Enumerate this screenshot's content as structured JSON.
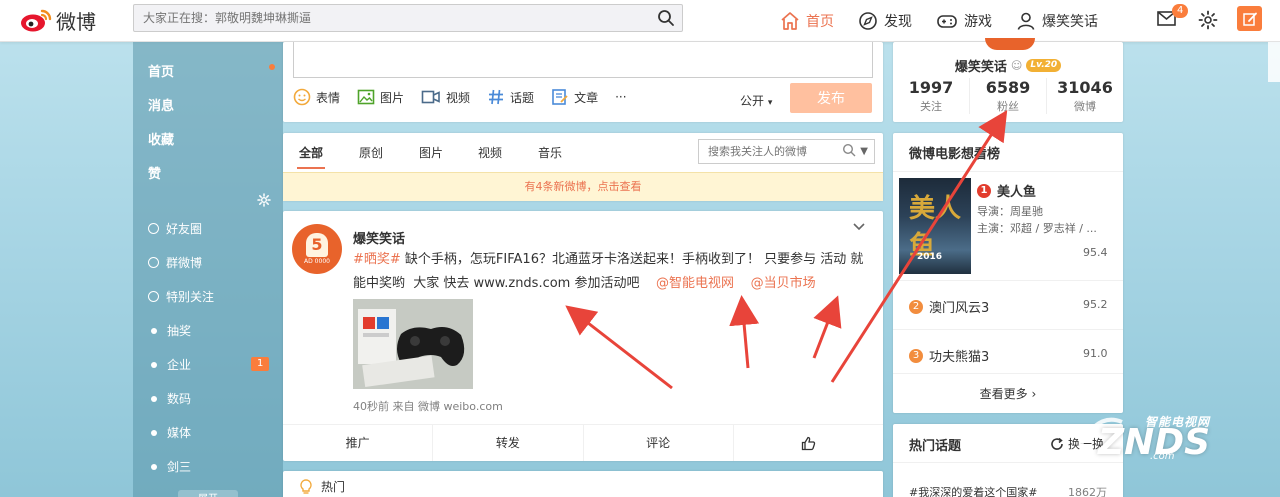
{
  "header": {
    "logo_text": "微博",
    "search_placeholder": "大家正在搜：郭敬明魏坤琳撕逼",
    "nav": [
      {
        "label": "首页",
        "icon": "home-icon"
      },
      {
        "label": "发现",
        "icon": "compass-icon"
      },
      {
        "label": "游戏",
        "icon": "gamepad-icon"
      },
      {
        "label": "爆笑笑话",
        "icon": "user-icon"
      }
    ],
    "mail_badge": "4"
  },
  "sidebar": {
    "main_items": [
      "首页",
      "消息",
      "收藏",
      "赞"
    ],
    "groups": [
      {
        "label": "好友圈",
        "type": "icon"
      },
      {
        "label": "群微博",
        "type": "icon"
      },
      {
        "label": "特别关注",
        "type": "icon"
      },
      {
        "label": "抽奖",
        "type": "dot"
      },
      {
        "label": "企业",
        "type": "dot",
        "badge": "1"
      },
      {
        "label": "数码",
        "type": "dot"
      },
      {
        "label": "媒体",
        "type": "dot"
      },
      {
        "label": "剑三",
        "type": "dot"
      }
    ],
    "more_label": "展开"
  },
  "publisher": {
    "tools": [
      "表情",
      "图片",
      "视频",
      "话题",
      "文章"
    ],
    "more": "···",
    "visibility": "公开",
    "submit": "发布"
  },
  "feed_tabs": {
    "tabs": [
      "全部",
      "原创",
      "图片",
      "视频",
      "音乐"
    ],
    "search_placeholder": "搜索我关注人的微博",
    "notice": "有4条新微博，点击查看"
  },
  "post": {
    "author": "爆笑笑话",
    "avatar_text": "5",
    "avatar_sub": "AD 0000",
    "hashtag": "#晒奖#",
    "text": " 缺个手柄，怎玩FIFA16？北通蓝牙卡洛送起来！手柄收到了！ 只要参与 活动 就能中奖哟  大家 快去 www.znds.com 参加活动吧    ",
    "mention1": "@智能电视网",
    "mention2": "@当贝市场",
    "meta": "40秒前 来自 微博 weibo.com",
    "actions": [
      "推广",
      "转发",
      "评论",
      ""
    ]
  },
  "hot": {
    "label": "热门"
  },
  "profile": {
    "name": "爆笑笑话",
    "level": "Lv.20",
    "stats": [
      {
        "value": "1997",
        "label": "关注"
      },
      {
        "value": "6589",
        "label": "粉丝"
      },
      {
        "value": "31046",
        "label": "微博"
      }
    ]
  },
  "movies": {
    "title": "微博电影想看榜",
    "poster_title": "美人鱼",
    "poster_year": "2016",
    "top": {
      "rank": "1",
      "name": "美人鱼",
      "director": "导演：周星驰",
      "cast": "主演：邓超 / 罗志祥 / ...",
      "score": "95.4"
    },
    "others": [
      {
        "rank": "2",
        "name": "澳门风云3",
        "score": "95.2"
      },
      {
        "rank": "3",
        "name": "功夫熊猫3",
        "score": "91.0"
      }
    ],
    "more": "查看更多"
  },
  "topics": {
    "title": "热门话题",
    "refresh": "换一换",
    "item": "#我深深的爱着这个国家#",
    "count": "1862万"
  },
  "watermark": {
    "top": "智能电视网",
    "main": "ZNDS",
    "url": ".com"
  },
  "colors": {
    "accent": "#eb7350",
    "orange": "#fa7d3c",
    "arrow": "#e8443a"
  }
}
